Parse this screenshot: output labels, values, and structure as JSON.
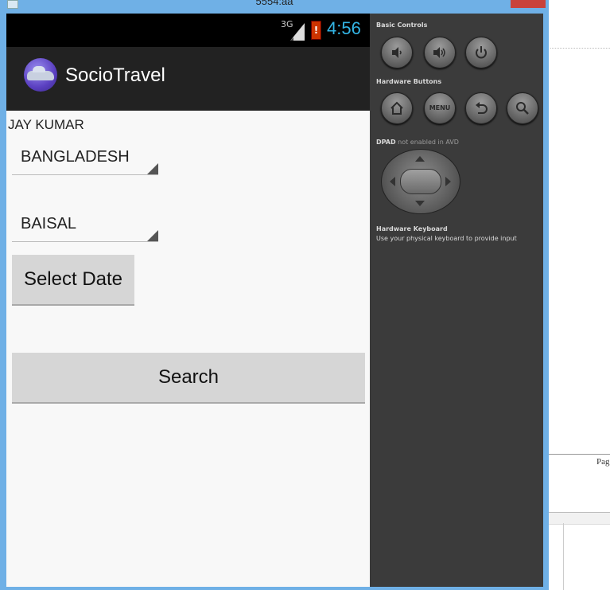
{
  "window": {
    "title": "5554:aa"
  },
  "status_bar": {
    "network": "3G",
    "battery_icon": "!",
    "time": "4:56"
  },
  "action_bar": {
    "app_title": "SocioTravel",
    "logo_icon": "car-logo-icon"
  },
  "content": {
    "user_name": "JAY KUMAR",
    "country_spinner": {
      "selected": "BANGLADESH"
    },
    "city_spinner": {
      "selected": "BAISAL"
    },
    "select_date_label": "Select Date",
    "search_label": "Search"
  },
  "controls_panel": {
    "basic_controls_label": "Basic Controls",
    "basic_buttons": [
      "volume-down-icon",
      "volume-up-icon",
      "power-icon"
    ],
    "hardware_buttons_label": "Hardware Buttons",
    "hardware_buttons": [
      "home-icon",
      "menu",
      "back-icon",
      "search-icon"
    ],
    "menu_label": "MENU",
    "dpad_label_bold": "DPAD",
    "dpad_label_rest": " not enabled in AVD",
    "keyboard_label": "Hardware Keyboard",
    "keyboard_hint": "Use your physical keyboard to provide input"
  },
  "background_document": {
    "page_label": "Pag"
  },
  "colors": {
    "accent": "#33b5e5",
    "action_bar": "#222222",
    "panel": "#3b3b3b",
    "frame": "#6fb0e6"
  }
}
